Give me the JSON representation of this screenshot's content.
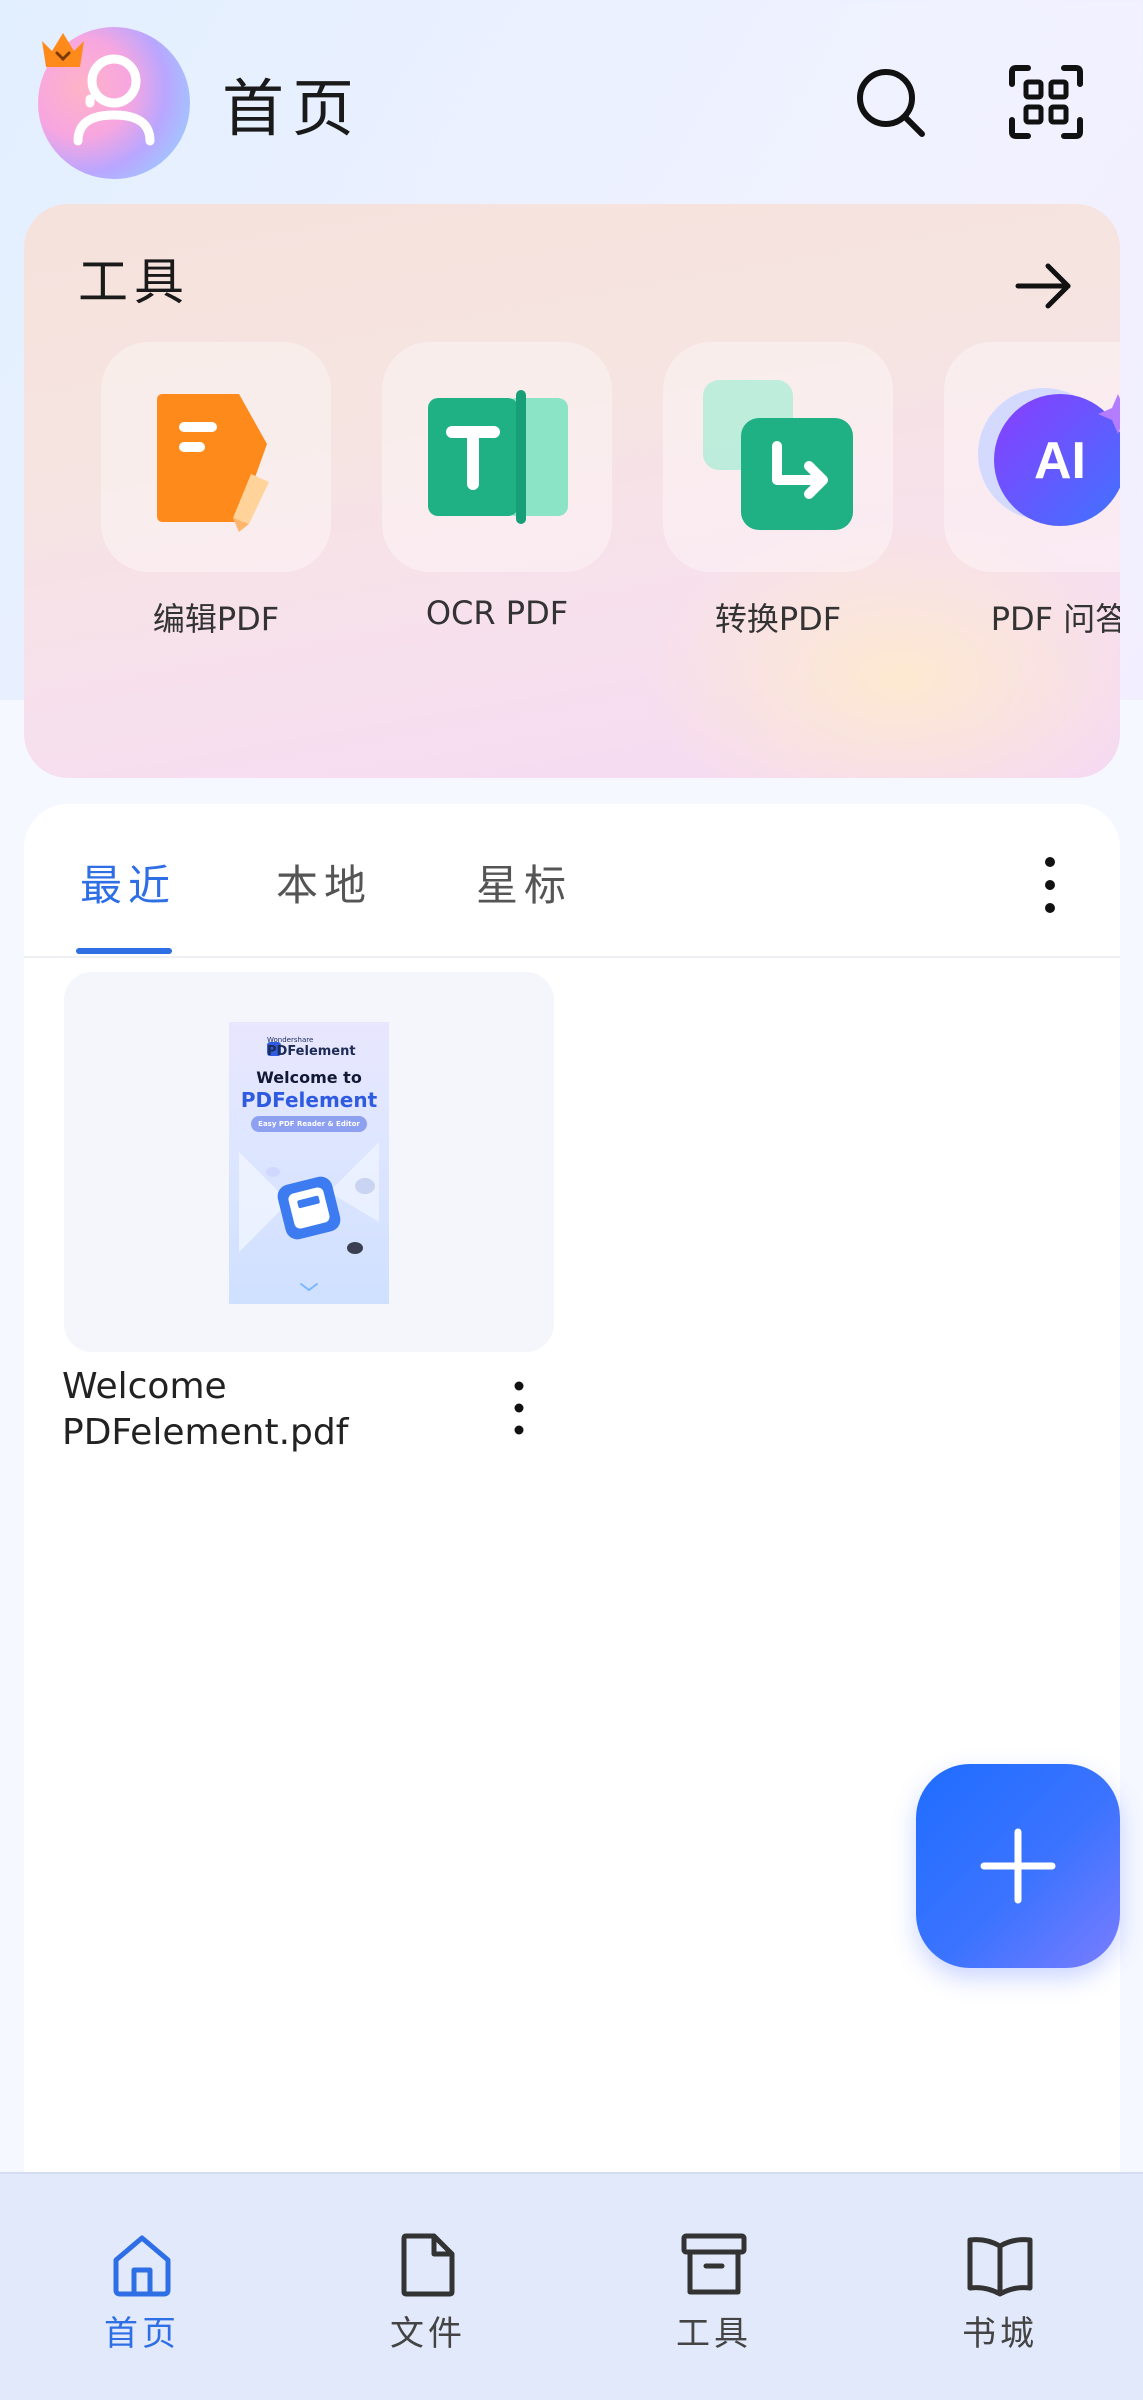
{
  "header": {
    "title": "首页",
    "avatar_icon": "user-avatar-icon",
    "crown_icon": "vip-crown-icon",
    "search_icon": "search-icon",
    "scan_icon": "scan-icon"
  },
  "tools": {
    "title": "工具",
    "arrow_icon": "arrow-right-icon",
    "items": [
      {
        "label": "编辑PDF",
        "icon": "edit-pdf-icon",
        "color": "#ff8a1c"
      },
      {
        "label": "OCR PDF",
        "icon": "ocr-pdf-icon",
        "color": "#22b58a"
      },
      {
        "label": "转换PDF",
        "icon": "convert-pdf-icon",
        "color": "#1fb886"
      },
      {
        "label": "PDF 问答",
        "icon": "ai-chat-icon",
        "color": "#6a4dff"
      }
    ]
  },
  "files": {
    "tabs": [
      {
        "label": "最近",
        "active": true
      },
      {
        "label": "本地",
        "active": false
      },
      {
        "label": "星标",
        "active": false
      }
    ],
    "more_icon": "more-vertical-icon",
    "items": [
      {
        "name_line1": "Welcome",
        "name_line2": "PDFelement.pdf",
        "cover": {
          "brand_top": "Wondershare",
          "brand": "PDFelement",
          "line1": "Welcome to",
          "line2": "PDFelement",
          "pill": "Easy PDF Reader & Editor"
        }
      }
    ]
  },
  "fab": {
    "icon": "plus-icon"
  },
  "bottom_nav": {
    "accent": "#2f6fe6",
    "items": [
      {
        "label": "首页",
        "icon": "home-icon",
        "active": true
      },
      {
        "label": "文件",
        "icon": "file-icon",
        "active": false
      },
      {
        "label": "工具",
        "icon": "toolbox-icon",
        "active": false
      },
      {
        "label": "书城",
        "icon": "book-icon",
        "active": false
      }
    ]
  }
}
